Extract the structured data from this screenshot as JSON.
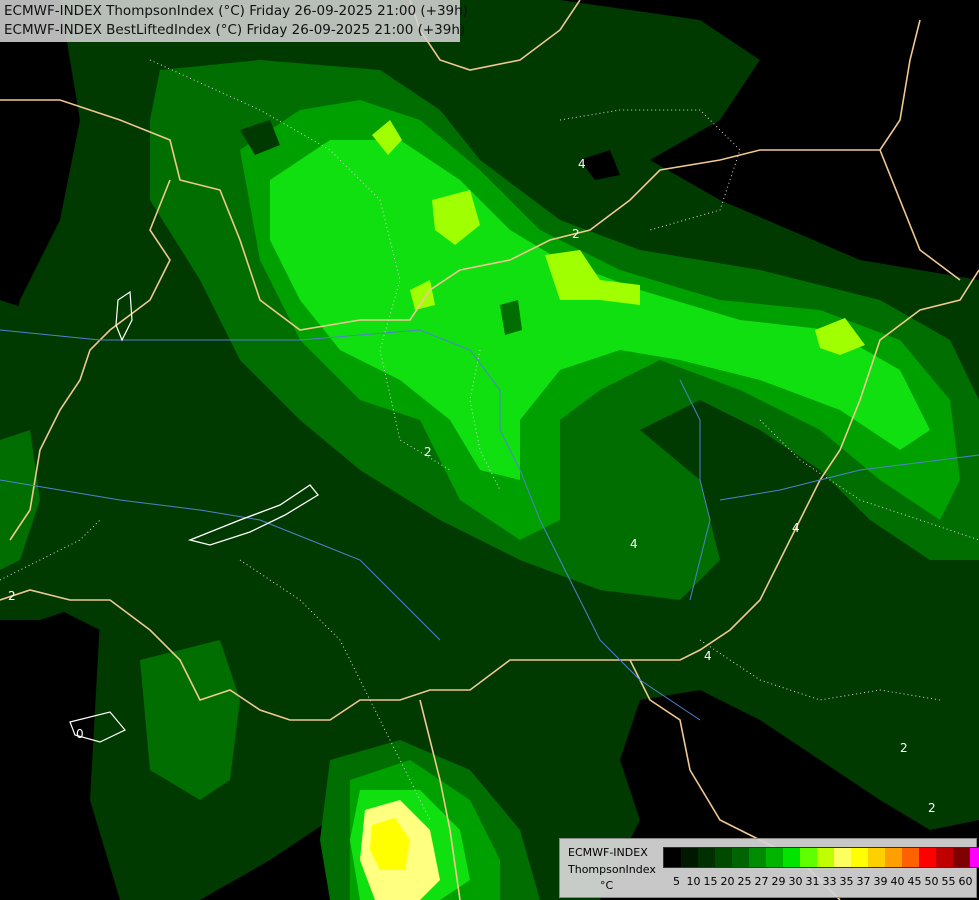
{
  "title": {
    "line1": "ECMWF-INDEX ThompsonIndex (°C) Friday 26-09-2025 21:00 (+39h)",
    "line2": "ECMWF-INDEX BestLiftedIndex (°C) Friday 26-09-2025 21:00 (+39h)"
  },
  "legend": {
    "source": "ECMWF-INDEX",
    "parameter": "ThompsonIndex",
    "unit": "°C",
    "colors": [
      "#000000",
      "#001800",
      "#003000",
      "#004a00",
      "#006400",
      "#008c00",
      "#00b400",
      "#00e400",
      "#60ff00",
      "#c0ff00",
      "#ffff60",
      "#ffff00",
      "#ffd000",
      "#ffa000",
      "#ff6000",
      "#ff0000",
      "#c00000",
      "#800000",
      "#ff00ff",
      "#c000ff",
      "#8000ff",
      "#4000ff",
      "#0000ff"
    ],
    "ticks": [
      "5",
      "10",
      "15",
      "20",
      "25",
      "27",
      "29",
      "30",
      "31",
      "33",
      "35",
      "37",
      "39",
      "40",
      "45",
      "50",
      "55",
      "60"
    ]
  },
  "contour_labels": [
    "2",
    "2",
    "4",
    "4",
    "4",
    "4",
    "2",
    "2",
    "0",
    "2"
  ]
}
